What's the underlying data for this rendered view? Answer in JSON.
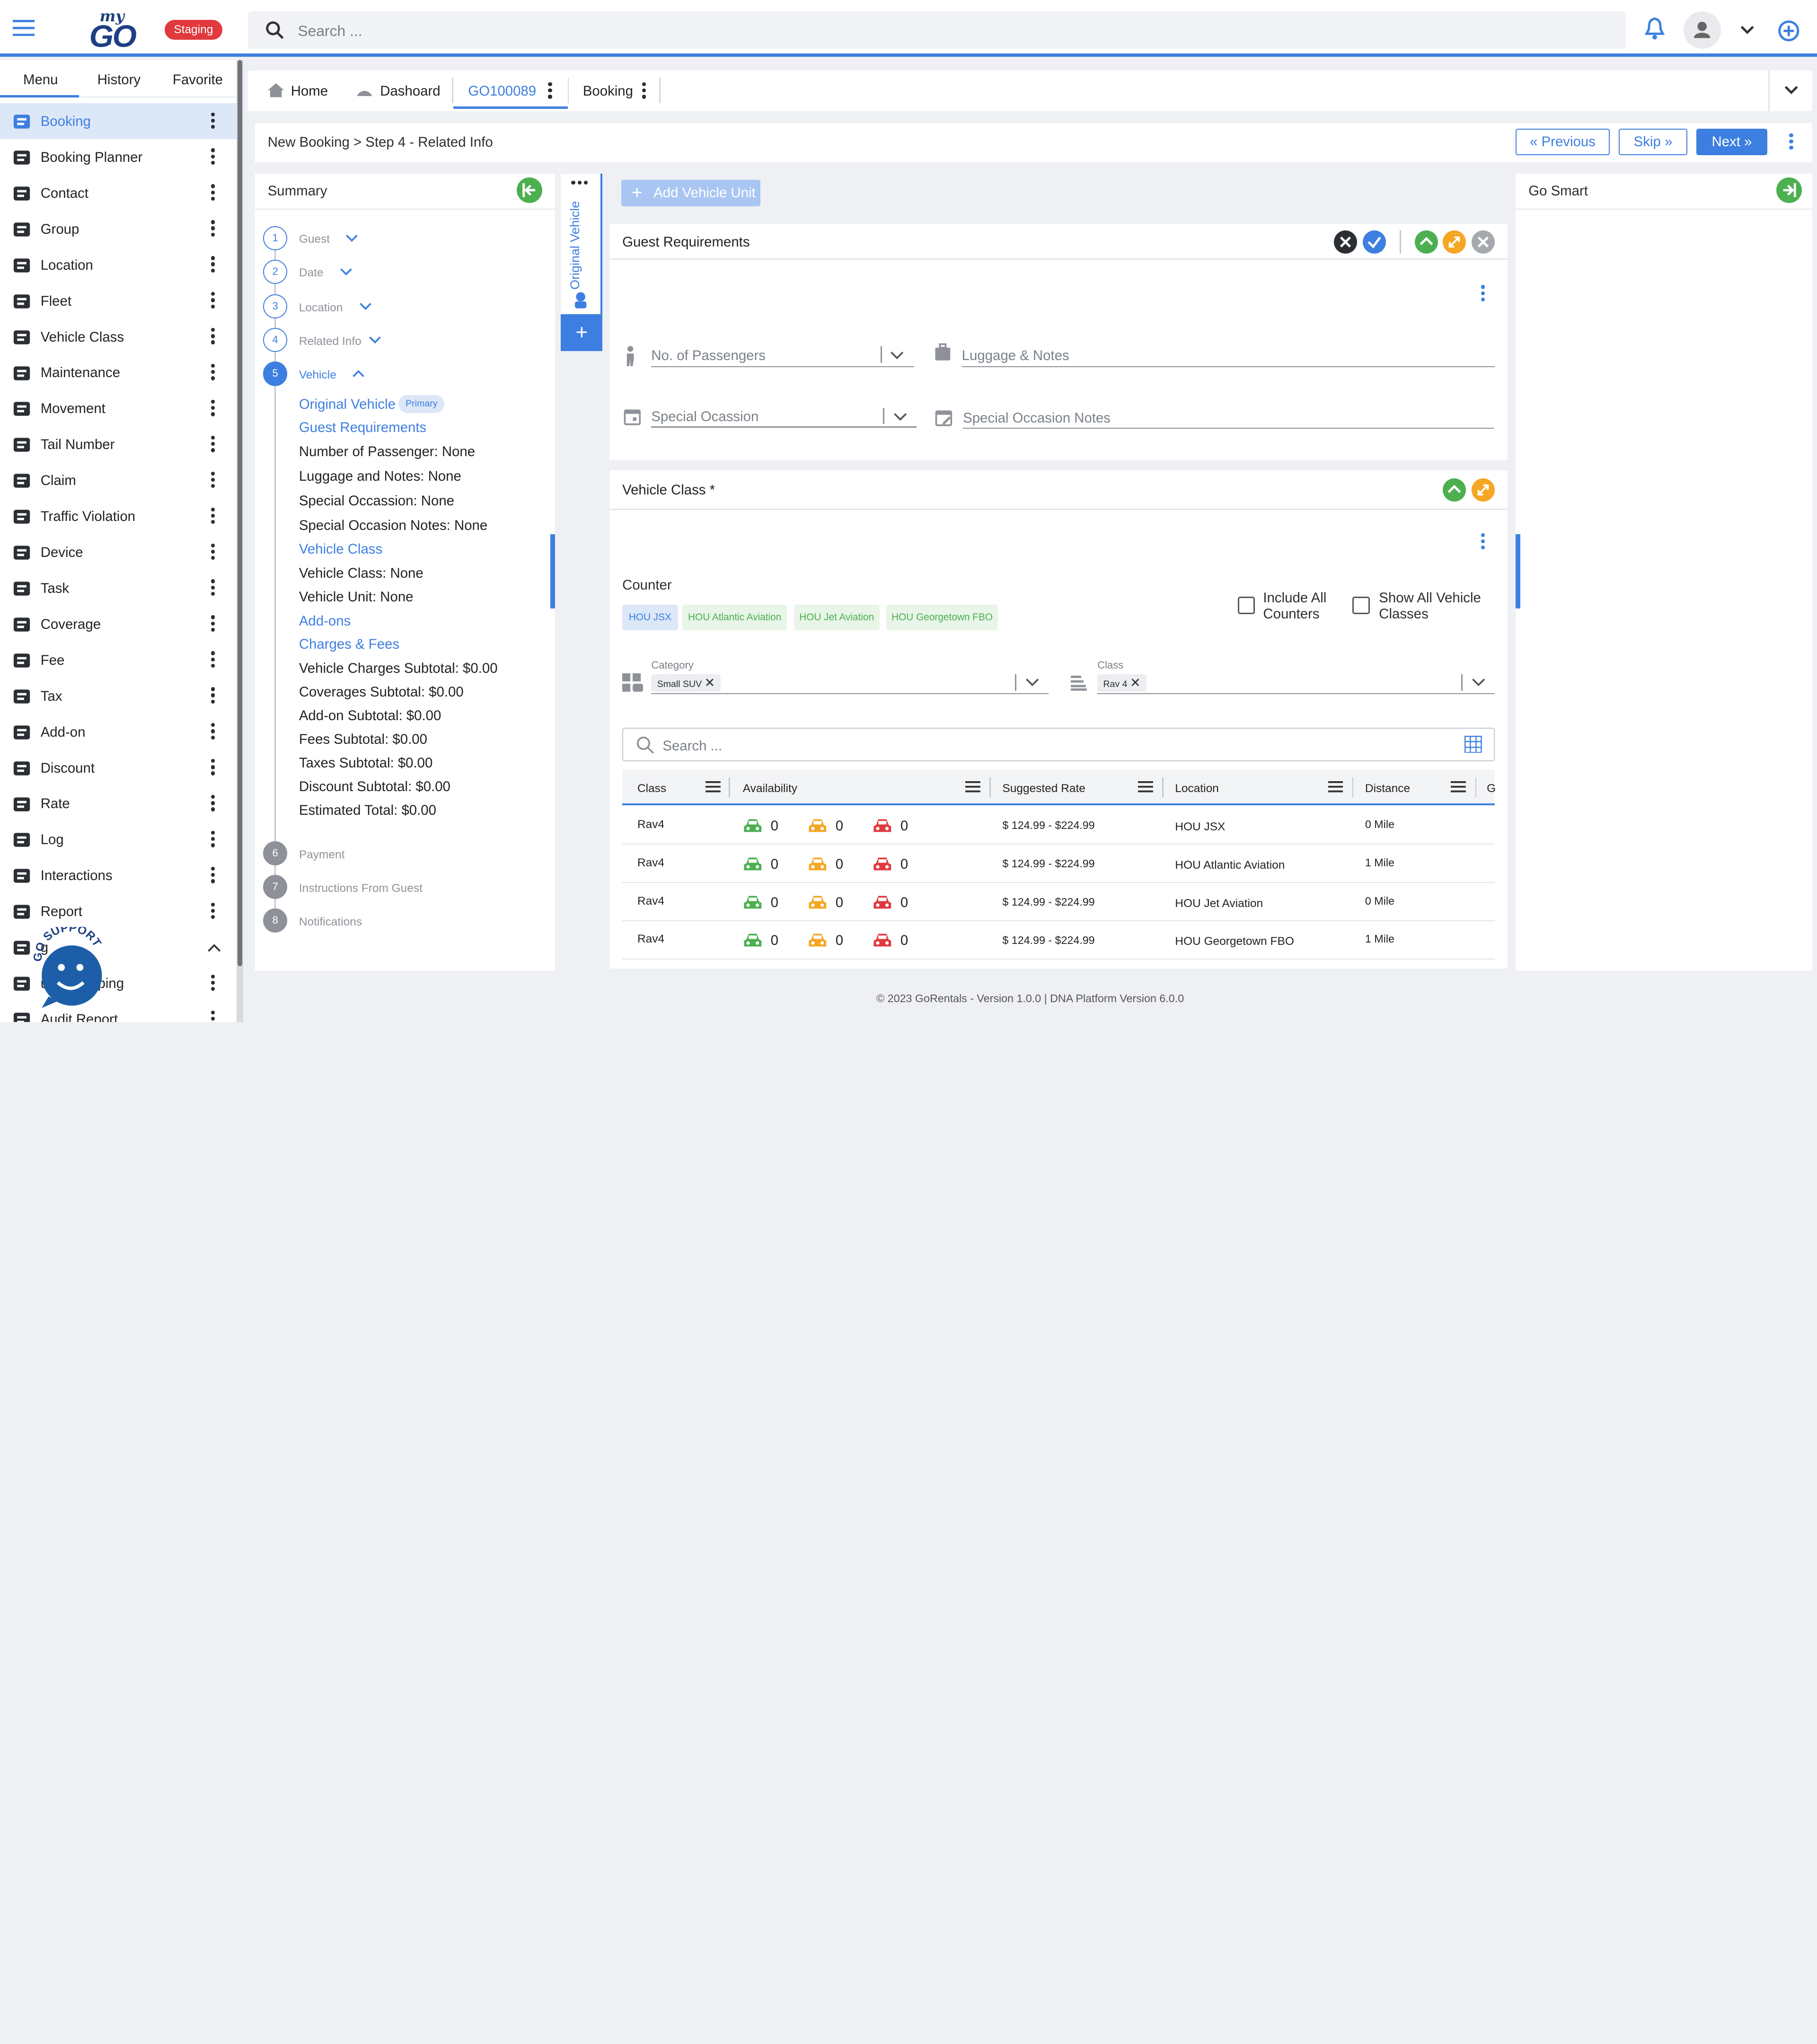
{
  "app": {
    "logo_small": "my",
    "logo_big": "GO",
    "env_badge": "Staging",
    "search_placeholder": "Search ..."
  },
  "nav": {
    "tabs": [
      "Menu",
      "History",
      "Favorite"
    ],
    "items": [
      {
        "label": "Booking",
        "icon": "booking-icon",
        "active": true
      },
      {
        "label": "Booking Planner",
        "icon": "calendar-clock-icon"
      },
      {
        "label": "Contact",
        "icon": "phone-icon"
      },
      {
        "label": "Group",
        "icon": "building-icon"
      },
      {
        "label": "Location",
        "icon": "map-pin-icon"
      },
      {
        "label": "Fleet",
        "icon": "car-icon"
      },
      {
        "label": "Vehicle Class",
        "icon": "stack-icon"
      },
      {
        "label": "Maintenance",
        "icon": "gears-icon"
      },
      {
        "label": "Movement",
        "icon": "wheel-icon"
      },
      {
        "label": "Tail Number",
        "icon": "plane-icon"
      },
      {
        "label": "Claim",
        "icon": "document-icon"
      },
      {
        "label": "Traffic Violation",
        "icon": "parking-ticket-icon"
      },
      {
        "label": "Device",
        "icon": "tablet-icon"
      },
      {
        "label": "Task",
        "icon": "task-icon"
      },
      {
        "label": "Coverage",
        "icon": "coverage-icon"
      },
      {
        "label": "Fee",
        "icon": "fee-icon"
      },
      {
        "label": "Tax",
        "icon": "tax-icon"
      },
      {
        "label": "Add-on",
        "icon": "puzzle-icon"
      },
      {
        "label": "Discount",
        "icon": "percent-icon"
      },
      {
        "label": "Rate",
        "icon": "rate-icon"
      },
      {
        "label": "Log",
        "icon": "log-icon"
      },
      {
        "label": "Interactions",
        "icon": "chat-icon"
      },
      {
        "label": "Report",
        "icon": "chart-icon"
      },
      {
        "label": "g",
        "icon": "settings-icon",
        "expanded": true
      },
      {
        "label": "unts Mapping",
        "icon": "mapping-icon"
      },
      {
        "label": "Audit Report",
        "icon": "audit-icon"
      }
    ],
    "support_label": "GO SUPPORT"
  },
  "tabs": [
    {
      "label": "Home"
    },
    {
      "label": "Dashoard"
    },
    {
      "label": "GO100089",
      "active": true
    },
    {
      "label": "Booking"
    }
  ],
  "step": {
    "breadcrumb": "New Booking > Step 4 - Related Info",
    "previous": "Previous",
    "skip": "Skip",
    "next": "Next"
  },
  "summary": {
    "title": "Summary",
    "steps": [
      {
        "num": "1",
        "label": "Guest"
      },
      {
        "num": "2",
        "label": "Date"
      },
      {
        "num": "3",
        "label": "Location"
      },
      {
        "num": "4",
        "label": "Related Info"
      },
      {
        "num": "5",
        "label": "Vehicle"
      },
      {
        "num": "6",
        "label": "Payment"
      },
      {
        "num": "7",
        "label": "Instructions From Guest"
      },
      {
        "num": "8",
        "label": "Notifications"
      }
    ],
    "original_vehicle": "Original Vehicle",
    "primary_badge": "Primary",
    "guest_requirements": "Guest Requirements",
    "lines1": [
      "Number of Passenger: None",
      "Luggage and Notes: None",
      "Special Occassion: None",
      "Special Occasion Notes: None"
    ],
    "vehicle_class": "Vehicle Class",
    "lines2": [
      "Vehicle Class: None",
      "Vehicle Unit: None"
    ],
    "addons": "Add-ons",
    "charges": "Charges & Fees",
    "lines3": [
      "Vehicle Charges Subtotal: $0.00",
      "Coverages Subtotal: $0.00",
      "Add-on Subtotal: $0.00",
      "Fees Subtotal: $0.00",
      "Taxes Subtotal: $0.00",
      "Discount Subtotal: $0.00",
      "Estimated Total: $0.00"
    ]
  },
  "vehicle_tab": {
    "label": "Original Vehicle"
  },
  "add_unit": "Add Vehicle Unit",
  "guest_req": {
    "title": "Guest Requirements",
    "passengers": "No. of Passengers",
    "luggage": "Luggage & Notes",
    "occasion": "Special Ocassion",
    "occasion_notes": "Special Occasion Notes"
  },
  "vclass": {
    "title": "Vehicle Class *",
    "counter_label": "Counter",
    "counters": [
      "HOU JSX",
      "HOU Atlantic Aviation",
      "HOU Jet Aviation",
      "HOU Georgetown FBO"
    ],
    "include_all": [
      "Include All",
      "Counters"
    ],
    "show_all": [
      "Show All Vehicle",
      "Classes"
    ],
    "category_label": "Category",
    "category_chip": "Small SUV",
    "class_label": "Class",
    "class_chip": "Rav 4",
    "search_placeholder": "Search ...",
    "columns": [
      "Class",
      "Availability",
      "Suggested Rate",
      "Location",
      "Distance",
      "G"
    ],
    "rows": [
      {
        "class": "Rav4",
        "green": "0",
        "orange": "0",
        "red": "0",
        "rate": "$ 124.99 - $224.99",
        "location": "HOU JSX",
        "distance": "0 Mile"
      },
      {
        "class": "Rav4",
        "green": "0",
        "orange": "0",
        "red": "0",
        "rate": "$ 124.99 - $224.99",
        "location": "HOU Atlantic Aviation",
        "distance": "1 Mile"
      },
      {
        "class": "Rav4",
        "green": "0",
        "orange": "0",
        "red": "0",
        "rate": "$ 124.99 - $224.99",
        "location": "HOU Jet Aviation",
        "distance": "0 Mile"
      },
      {
        "class": "Rav4",
        "green": "0",
        "orange": "0",
        "red": "0",
        "rate": "$ 124.99 - $224.99",
        "location": "HOU Georgetown FBO",
        "distance": "1 Mile"
      }
    ]
  },
  "gosmart": {
    "title": "Go Smart"
  },
  "footer": "©  2023 GoRentals - Version 1.0.0 | DNA Platform Version 6.0.0",
  "colors": {
    "accent": "#3d7fe0",
    "green": "#4caf50",
    "orange": "#f5a623",
    "red": "#e0393e"
  }
}
